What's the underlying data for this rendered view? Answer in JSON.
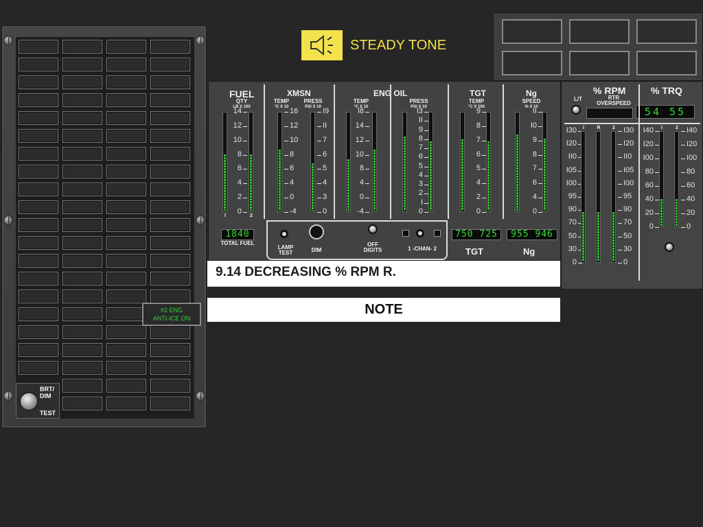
{
  "audio": {
    "icon": "speaker-icon",
    "label": "STEADY TONE"
  },
  "caution_panel": {
    "advisory": [
      "#2 ENG",
      "ANTI-ICE ON"
    ],
    "control": {
      "label_top": [
        "BRT/",
        "DIM"
      ],
      "label_bottom": "TEST"
    }
  },
  "engine_panel": {
    "fuel": {
      "title": "FUEL",
      "sub": [
        "QTY",
        "LB X 100"
      ],
      "scale": [
        "14",
        "12",
        "10",
        "8",
        "6",
        "4",
        "2",
        "0"
      ],
      "digital": "1840",
      "footer": "TOTAL FUEL",
      "level": [
        0.57,
        0.57
      ]
    },
    "xmsn": {
      "title": "XMSN",
      "temp": {
        "sub": [
          "TEMP",
          "°C X 10"
        ],
        "scale": [
          "16",
          "12",
          "10",
          "8",
          "6",
          "4",
          "0",
          "-4"
        ],
        "level": 0.62
      },
      "press": {
        "sub": [
          "PRESS",
          "PSI X 10"
        ],
        "scale": [
          "I9",
          "II",
          "7",
          "6",
          "5",
          "4",
          "3",
          "0"
        ],
        "level": 0.48
      }
    },
    "eng_oil": {
      "title": "ENG OIL",
      "temp": {
        "sub": [
          "TEMP",
          "°C X 10"
        ],
        "scale": [
          "I8",
          "14",
          "12",
          "10",
          "8",
          "4",
          "0",
          "-4"
        ],
        "level": [
          0.52,
          0.62
        ]
      },
      "press": {
        "sub": [
          "PRESS",
          "PSI X 10"
        ],
        "scale": [
          "I3",
          "II",
          "9",
          "8",
          "7",
          "6",
          "5",
          "4",
          "3",
          "2",
          "I",
          "0"
        ],
        "level": [
          0.75,
          0.7
        ]
      }
    },
    "tgt": {
      "title": "TGT",
      "sub": [
        "TEMP",
        "°C X 100"
      ],
      "scale": [
        "9",
        "8",
        "7",
        "6",
        "5",
        "4",
        "2",
        "0"
      ],
      "digital": "750 725",
      "footer": "TGT",
      "level": [
        0.72,
        0.7
      ]
    },
    "ng": {
      "title": "Ng",
      "sub": [
        "SPEED",
        "% X 10"
      ],
      "scale": [
        "II",
        "I0",
        "9",
        "8",
        "7",
        "6",
        "4",
        "0"
      ],
      "digital": "955 946",
      "footer": "Ng",
      "level": [
        0.77,
        0.73
      ]
    },
    "controls": {
      "lamp_test": [
        "LAMP",
        "TEST"
      ],
      "dim": "DIM",
      "digits": [
        "OFF",
        "DIGITS"
      ],
      "chan": "1 -CHAN- 2"
    },
    "bar_labels": [
      "I",
      "2"
    ]
  },
  "rpm_trq_panel": {
    "lt": "L/T",
    "rpm_title": "% RPM",
    "rtr_overspeed": [
      "RTR",
      "OVERSPEED"
    ],
    "trq_title": "% TRQ",
    "trq_digits": "54 55",
    "rpm_scale": [
      "I30",
      "I20",
      "II0",
      "I05",
      "I00",
      "95",
      "90",
      "70",
      "50",
      "30",
      "0"
    ],
    "rpm_scale_right": [
      "I30",
      "I20",
      "II0",
      "I05",
      "I00",
      "95",
      "90",
      "70",
      "50",
      "30",
      "0"
    ],
    "trq_scale": [
      "I40",
      "I20",
      "I00",
      "80",
      "60",
      "40",
      "20",
      "0"
    ],
    "rpm_bar_labels": [
      "I",
      "R",
      "2"
    ],
    "trq_bar_labels": [
      "I",
      "2"
    ],
    "rpm_level": [
      0.38,
      0.38,
      0.38
    ],
    "trq_level": [
      0.28,
      0.28
    ]
  },
  "procedure": {
    "title": "9.14  DECREASING % RPM R.",
    "note": "NOTE"
  },
  "colors": {
    "accent_yellow": "#f3e24c",
    "segment_green": "#31c231",
    "advisory_green": "#36d336"
  }
}
